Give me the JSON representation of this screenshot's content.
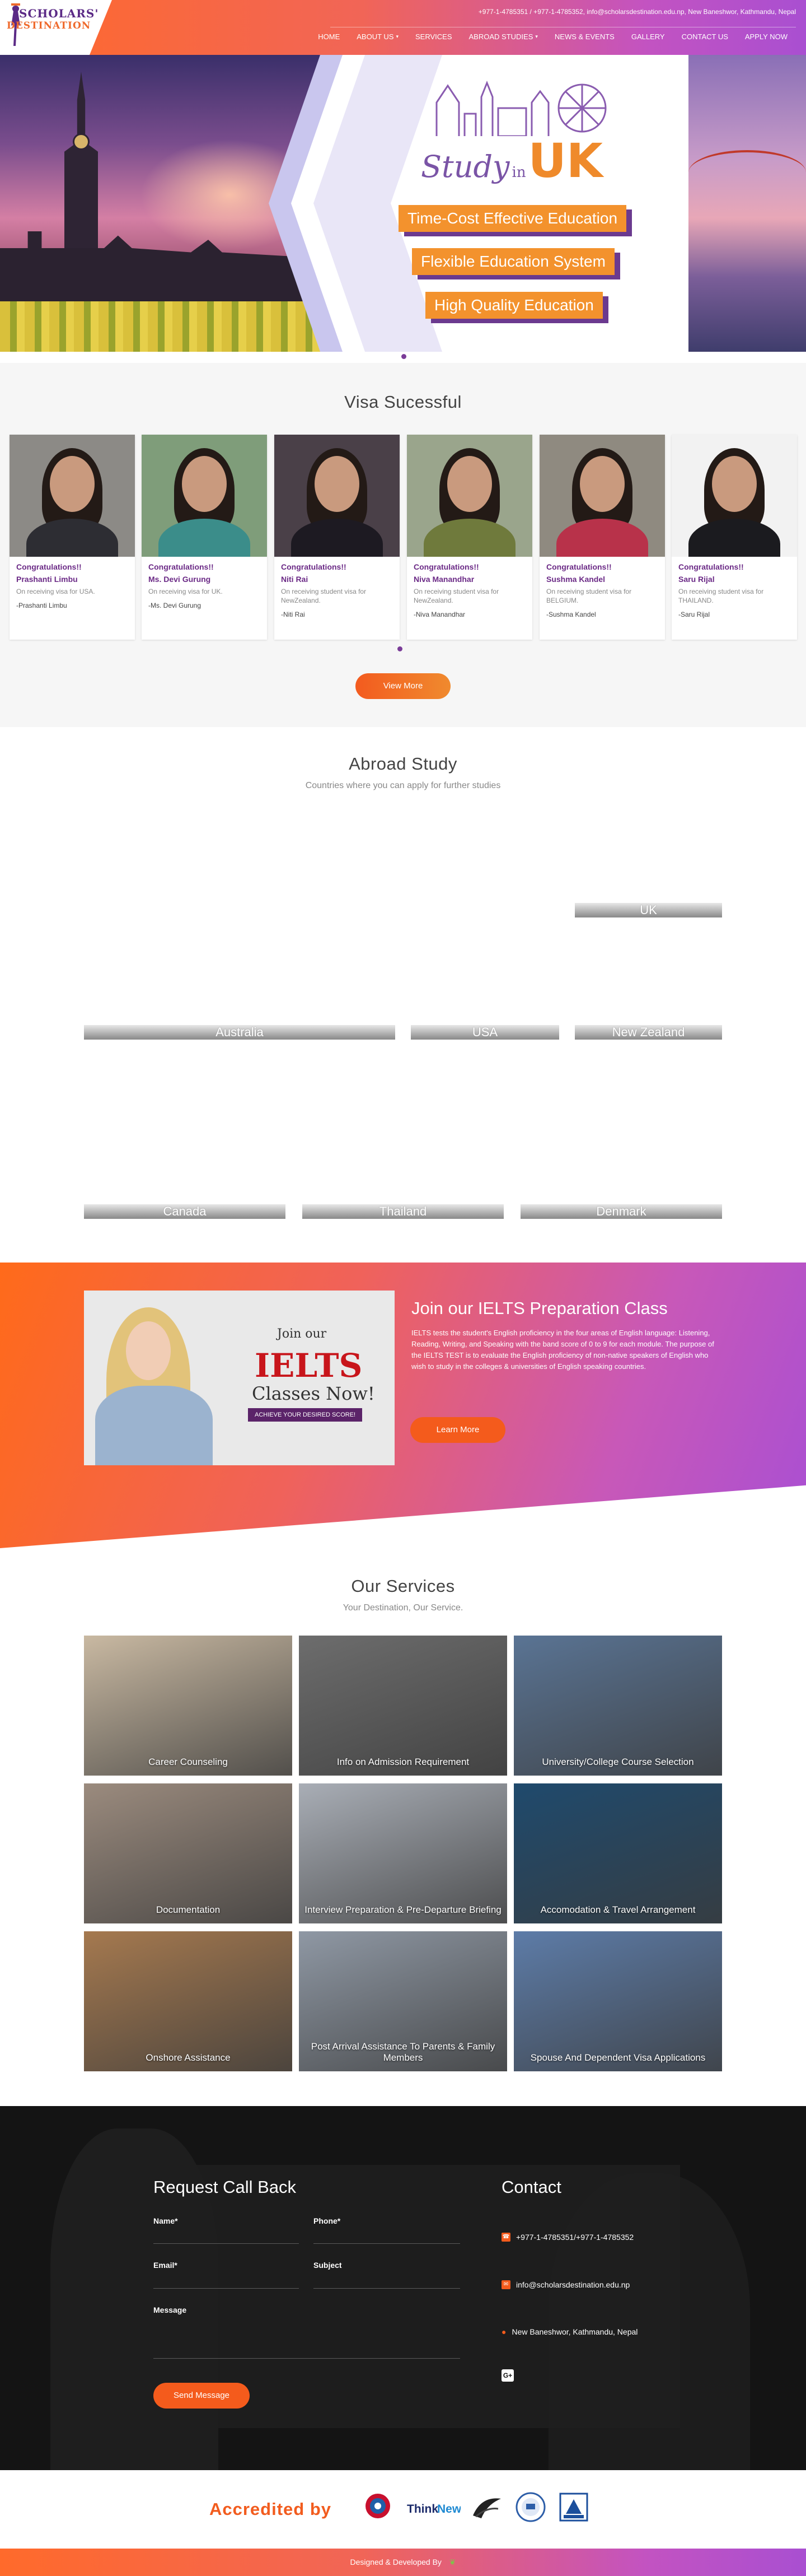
{
  "header": {
    "logo_line1": "SCHOLARS'",
    "logo_line2": "DESTINATION",
    "topbar_text": "+977-1-4785351 / +977-1-4785352, info@scholarsdestination.edu.np, New Baneshwor, Kathmandu, Nepal",
    "nav": [
      {
        "label": "HOME",
        "dropdown": false
      },
      {
        "label": "ABOUT US",
        "dropdown": true
      },
      {
        "label": "SERVICES",
        "dropdown": false
      },
      {
        "label": "ABROAD STUDIES",
        "dropdown": true
      },
      {
        "label": "NEWS & EVENTS",
        "dropdown": false
      },
      {
        "label": "GALLERY",
        "dropdown": false
      },
      {
        "label": "CONTACT US",
        "dropdown": false
      },
      {
        "label": "APPLY NOW",
        "dropdown": false
      }
    ]
  },
  "hero": {
    "study": "Study",
    "in": "in",
    "uk": "UK",
    "badges": [
      "Time-Cost Effective Education",
      "Flexible Education System",
      "High Quality Education"
    ]
  },
  "visa": {
    "title": "Visa Sucessful",
    "cards": [
      {
        "congrats": "Congratulations!!",
        "name": "Prashanti Limbu",
        "desc": "On receiving visa for USA.",
        "sign": "-Prashanti Limbu",
        "clothing": "#2d2d33",
        "backdrop": "#8c8a86"
      },
      {
        "congrats": "Congratulations!!",
        "name": "Ms. Devi Gurung",
        "desc": "On receiving visa for UK.",
        "sign": "-Ms. Devi Gurung",
        "clothing": "#3b8d8a",
        "backdrop": "#7f9d7a"
      },
      {
        "congrats": "Congratulations!!",
        "name": "Niti Rai",
        "desc": "On receiving student visa for NewZealand.",
        "sign": "-Niti Rai",
        "clothing": "#1d1a22",
        "backdrop": "#4a4048"
      },
      {
        "congrats": "Congratulations!!",
        "name": "Niva Manandhar",
        "desc": "On receiving student visa for NewZealand.",
        "sign": "-Niva Manandhar",
        "clothing": "#6f7a3c",
        "backdrop": "#9aa58c"
      },
      {
        "congrats": "Congratulations!!",
        "name": "Sushma Kandel",
        "desc": "On receiving student visa for BELGIUM.",
        "sign": "-Sushma Kandel",
        "clothing": "#b8324a",
        "backdrop": "#8f8a80"
      },
      {
        "congrats": "Congratulations!!",
        "name": "Saru Rijal",
        "desc": "On receiving student visa for THAILAND.",
        "sign": "-Saru Rijal",
        "clothing": "#1b1b1f",
        "backdrop": "#f2f2f2"
      }
    ],
    "view_more": "View More"
  },
  "abroad": {
    "title": "Abroad Study",
    "subtitle": "Countries where you can apply for further studies",
    "countries": [
      "UK",
      "Australia",
      "USA",
      "New Zealand",
      "Canada",
      "Thailand",
      "Denmark"
    ]
  },
  "ielts": {
    "image_join": "Join our",
    "image_ielts": "IELTS",
    "image_classes": "Classes Now!",
    "image_pill": "ACHIEVE YOUR DESIRED SCORE!",
    "title": "Join our IELTS Preparation Class",
    "text": "IELTS tests the student's English proficiency in the four areas of English language: Listening, Reading, Writing, and Speaking with the band score of 0 to 9 for each module. The purpose of the IELTS TEST is to evaluate the English proficiency of non-native speakers of English who wish to study in the colleges & universities of English speaking countries.",
    "button": "Learn More"
  },
  "services": {
    "title": "Our Services",
    "subtitle": "Your Destination, Our Service.",
    "items": [
      {
        "label": "Career Counseling",
        "tone": "#c9b9a2"
      },
      {
        "label": "Info on Admission Requirement",
        "tone": "#6d6d6d"
      },
      {
        "label": "University/College Course Selection",
        "tone": "#5a7494"
      },
      {
        "label": "Documentation",
        "tone": "#9b8b7e"
      },
      {
        "label": "Interview Preparation & Pre-Departure Briefing",
        "tone": "#a9aeb6"
      },
      {
        "label": "Accomodation & Travel Arrangement",
        "tone": "#1f4a6d"
      },
      {
        "label": "Onshore Assistance",
        "tone": "#a5794f"
      },
      {
        "label": "Post Arrival Assistance To Parents & Family Members",
        "tone": "#8f98a4"
      },
      {
        "label": "Spouse And Dependent Visa Applications",
        "tone": "#5d7ca8"
      }
    ]
  },
  "contact": {
    "form_title": "Request Call Back",
    "name_label": "Name*",
    "phone_label": "Phone*",
    "email_label": "Email*",
    "subject_label": "Subject",
    "message_label": "Message",
    "send_button": "Send Message",
    "title": "Contact",
    "phone": "+977-1-4785351/+977-1-4785352",
    "email": "info@scholarsdestination.edu.np",
    "address": "New Baneshwor, Kathmandu, Nepal",
    "social": "G+"
  },
  "accredited": {
    "label": "Accredited by",
    "logos": [
      "Nepal Government",
      "ThinkNew",
      "Education New Zealand",
      "ITI",
      "TEMPO"
    ]
  },
  "footer": {
    "text": "Designed & Developed By"
  },
  "colors": {
    "brand_orange": "#f45b1c",
    "brand_purple": "#6b2a86"
  }
}
